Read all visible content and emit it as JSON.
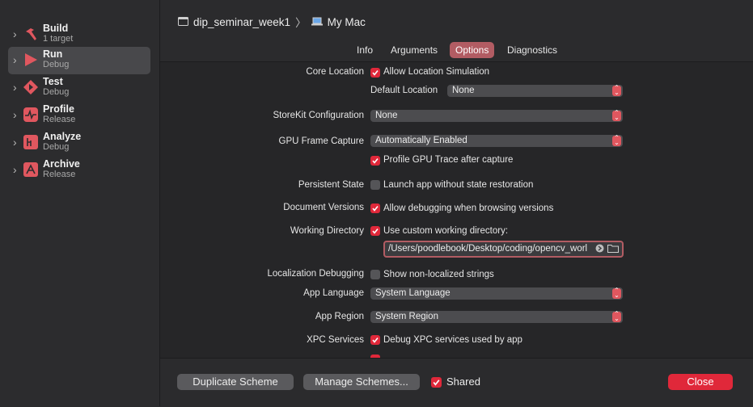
{
  "sidebar": {
    "items": [
      {
        "title": "Build",
        "subtitle": "1 target",
        "icon": "hammer-icon"
      },
      {
        "title": "Run",
        "subtitle": "Debug",
        "icon": "play-icon"
      },
      {
        "title": "Test",
        "subtitle": "Debug",
        "icon": "test-diamond-icon"
      },
      {
        "title": "Profile",
        "subtitle": "Release",
        "icon": "waveform-icon"
      },
      {
        "title": "Analyze",
        "subtitle": "Debug",
        "icon": "analyze-icon"
      },
      {
        "title": "Archive",
        "subtitle": "Release",
        "icon": "archive-icon"
      }
    ]
  },
  "header": {
    "scheme": "dip_seminar_week1",
    "destination": "My Mac",
    "separator": "〉"
  },
  "tabs": [
    "Info",
    "Arguments",
    "Options",
    "Diagnostics"
  ],
  "options": {
    "core_location": {
      "label": "Core Location",
      "checkbox": "Allow Location Simulation",
      "default_location_label": "Default Location",
      "default_location_value": "None"
    },
    "storekit": {
      "label": "StoreKit Configuration",
      "value": "None"
    },
    "gpu": {
      "label": "GPU Frame Capture",
      "value": "Automatically Enabled",
      "checkbox": "Profile GPU Trace after capture"
    },
    "persistent": {
      "label": "Persistent State",
      "checkbox": "Launch app without state restoration"
    },
    "docversions": {
      "label": "Document Versions",
      "checkbox": "Allow debugging when browsing versions"
    },
    "workdir": {
      "label": "Working Directory",
      "checkbox": "Use custom working directory:",
      "path": "/Users/poodlebook/Desktop/coding/opencv_worl"
    },
    "localization": {
      "label": "Localization Debugging",
      "checkbox": "Show non-localized strings"
    },
    "app_language": {
      "label": "App Language",
      "value": "System Language"
    },
    "app_region": {
      "label": "App Region",
      "value": "System Region"
    },
    "xpc": {
      "label": "XPC Services",
      "checkbox": "Debug XPC services used by app"
    }
  },
  "footer": {
    "duplicate": "Duplicate Scheme",
    "manage": "Manage Schemes...",
    "shared": "Shared",
    "close": "Close"
  },
  "colors": {
    "accent": "#e0283a",
    "tab_active": "#b25c63"
  }
}
